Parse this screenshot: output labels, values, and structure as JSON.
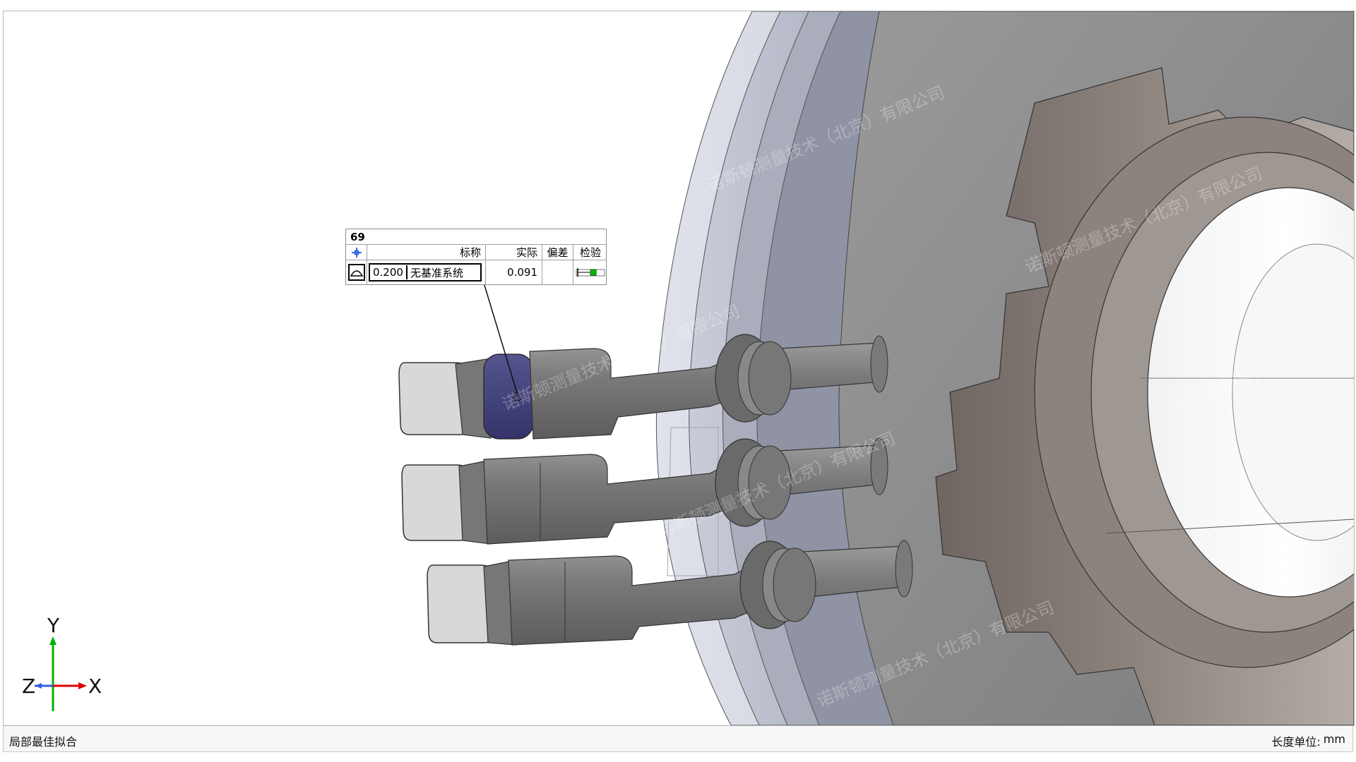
{
  "viewport": {
    "callout": {
      "id": "69",
      "header": {
        "nominal": "标称",
        "actual": "实际",
        "deviation": "偏差",
        "check": "检验"
      },
      "row": {
        "tolerance_value": "0.200",
        "datum": "无基准系统",
        "actual_value": "0.091",
        "deviation_value": ""
      },
      "check_status_color": "#00c000"
    },
    "triad": {
      "x_label": "X",
      "y_label": "Y",
      "z_label": "Z"
    },
    "watermark": "诺斯顿测量技术（北京）有限公司"
  },
  "statusbar": {
    "left_text": "局部最佳拟合",
    "unit_label": "长度单位:",
    "unit_value": "mm"
  }
}
